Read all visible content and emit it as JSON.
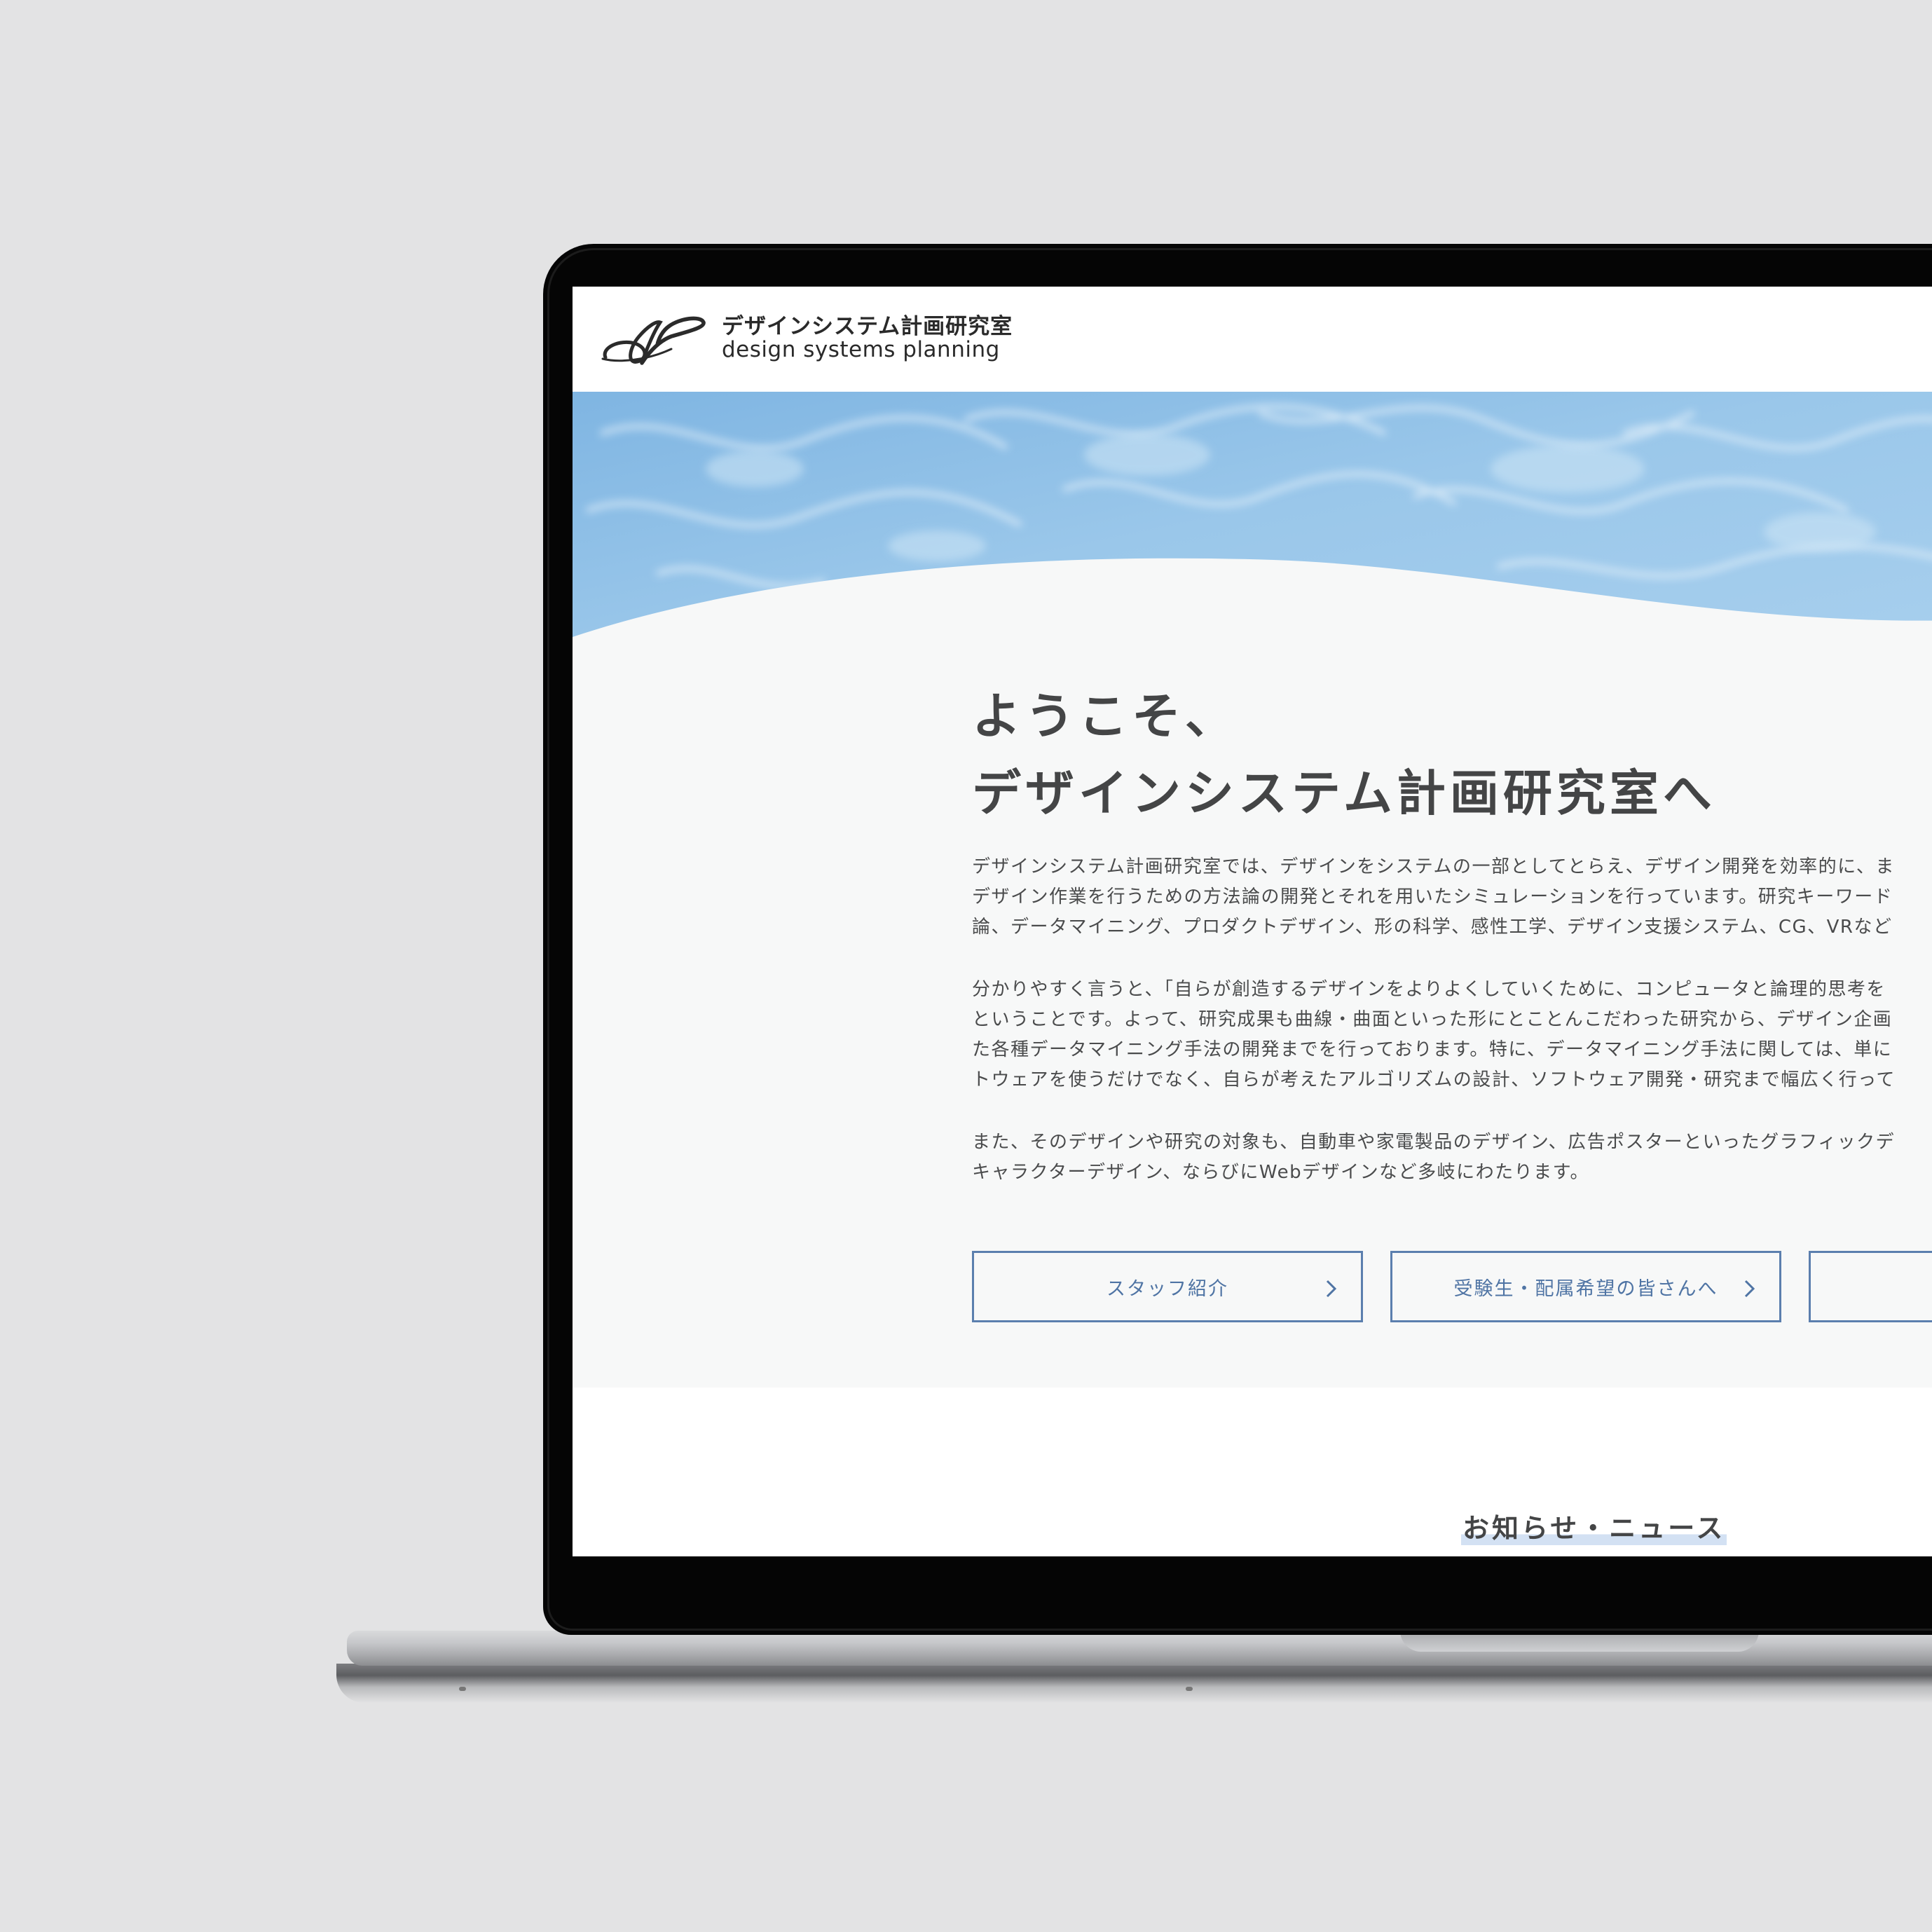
{
  "site": {
    "logo_jp": "デザインシステム計画研究室",
    "logo_en": "design systems planning",
    "logo_icon": "dsp-logo-mark"
  },
  "welcome": {
    "title_line1": "ようこそ、",
    "title_line2": "デザインシステム計画研究室へ"
  },
  "intro": {
    "p1": [
      "デザインシステム計画研究室では、デザインをシステムの一部としてとらえ、デザイン開発を効率的に、ま",
      "デザイン作業を行うための方法論の開発とそれを用いたシミュレーションを行っています。研究キーワード",
      "論、データマイニング、プロダクトデザイン、形の科学、感性工学、デザイン支援システム、CG、VRなど"
    ],
    "p2": [
      "分かりやすく言うと、「自らが創造するデザインをよりよくしていくために、コンピュータと論理的思考を",
      "ということです。よって、研究成果も曲線・曲面といった形にとことんこだわった研究から、デザイン企画",
      "た各種データマイニング手法の開発までを行っております。特に、データマイニング手法に関しては、単に",
      "トウェアを使うだけでなく、自らが考えたアルゴリズムの設計、ソフトウェア開発・研究まで幅広く行って"
    ],
    "p3": [
      "また、そのデザインや研究の対象も、自動車や家電製品のデザイン、広告ポスターといったグラフィックデ",
      "キャラクターデザイン、ならびにWebデザインなど多岐にわたります。"
    ]
  },
  "buttons": {
    "staff": "スタッフ紹介",
    "applicants": "受験生・配属希望の皆さんへ",
    "third": ""
  },
  "news": {
    "heading": "お知らせ・ニュース"
  },
  "colors": {
    "accent": "#5b7fae",
    "heading": "#444546",
    "body_text": "#4a4b4c",
    "content_bg": "#f7f8f8",
    "page_bg": "#e3e3e4",
    "hero_water": "#8fc0e6",
    "news_underline": "#d3e1f3"
  },
  "icons": {
    "button_arrow": "chevron-right-icon"
  }
}
